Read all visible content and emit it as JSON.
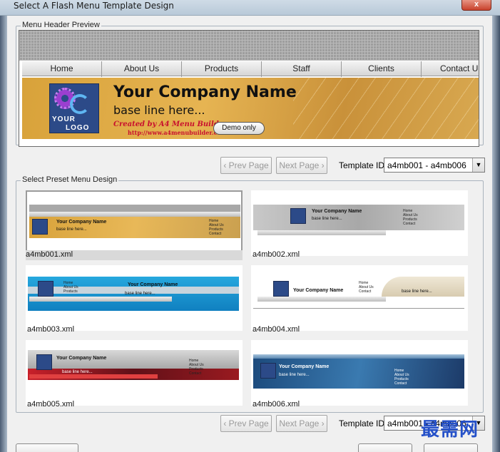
{
  "window": {
    "title": "Select A Flash Menu Template Design",
    "close_label": "x"
  },
  "header_group": {
    "legend": "Menu Header Preview"
  },
  "preview": {
    "nav_items": [
      "Home",
      "About Us",
      "Products",
      "Staff",
      "Clients",
      "Contact U"
    ],
    "company_name": "Your Company Name",
    "base_line": "base line here...",
    "logo_line1": "YOUR",
    "logo_line2": "LOGO",
    "created_by": "Created by A4 Menu Builder",
    "created_url": "http://www.a4menubuilder.com",
    "demo_label": "Demo only"
  },
  "pager": {
    "prev_label": "‹ Prev Page",
    "next_label": "Next Page ›",
    "template_id_label": "Template ID",
    "template_id_value": "a4mb001 - a4mb006"
  },
  "preset_group": {
    "legend": "Select Preset Menu Design"
  },
  "templates": [
    {
      "file": "a4mb001.xml",
      "title": "Your Company Name",
      "base": "base line here...",
      "selected": true
    },
    {
      "file": "a4mb002.xml",
      "title": "Your Company Name",
      "base": "base line here...",
      "selected": false
    },
    {
      "file": "a4mb003.xml",
      "title": "Your Company Name",
      "base": "base line here...",
      "selected": false
    },
    {
      "file": "a4mb004.xml",
      "title": "Your Company Name",
      "base": "base line here...",
      "selected": false
    },
    {
      "file": "a4mb005.xml",
      "title": "Your Company Name",
      "base": "base line here...",
      "selected": false
    },
    {
      "file": "a4mb006.xml",
      "title": "Your Company Name",
      "base": "base line here...",
      "selected": false
    }
  ],
  "mini_menu": [
    "Home",
    "About Us",
    "Products",
    "Contact"
  ],
  "watermark": "最需网",
  "colors": {
    "banner_gold": "#d8a23a",
    "blue_template": "#1aa0d8",
    "red_template": "#c8202a",
    "logo_blue": "#2c4a88"
  }
}
